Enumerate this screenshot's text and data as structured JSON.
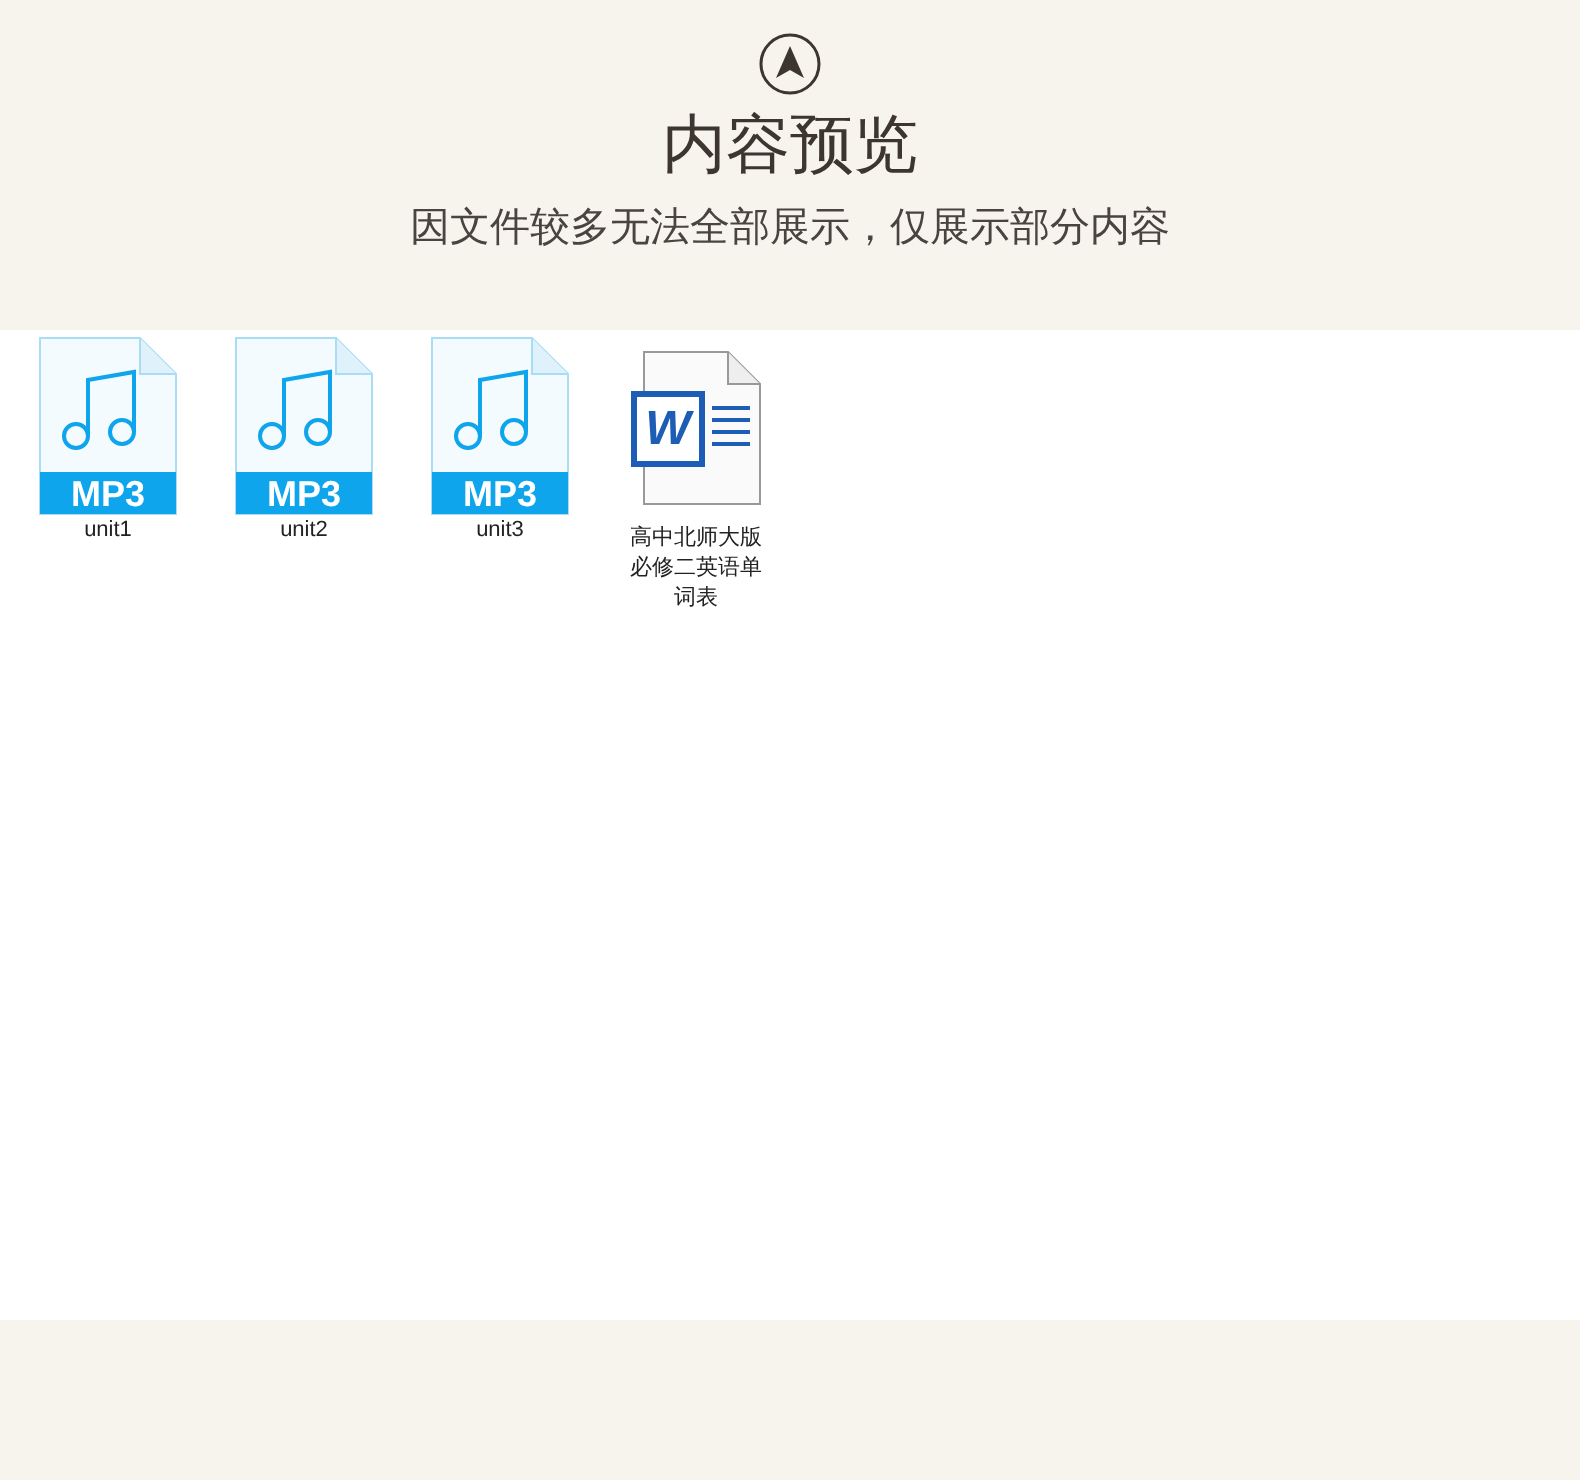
{
  "header": {
    "title": "内容预览",
    "subtitle": "因文件较多无法全部展示，仅展示部分内容"
  },
  "files": [
    {
      "kind": "mp3",
      "badge": "MP3",
      "name": "unit1"
    },
    {
      "kind": "mp3",
      "badge": "MP3",
      "name": "unit2"
    },
    {
      "kind": "mp3",
      "badge": "MP3",
      "name": "unit3"
    },
    {
      "kind": "word",
      "badge": "W",
      "name": "高中北师大版必修二英语单词表"
    }
  ]
}
